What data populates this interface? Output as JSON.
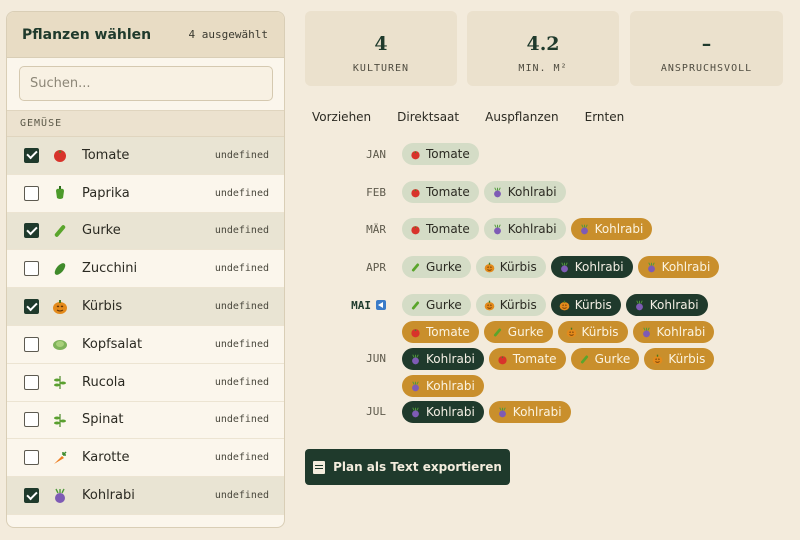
{
  "panel": {
    "title": "Pflanzen wählen",
    "count": "4 ausgewählt",
    "search_placeholder": "Suchen...",
    "group": "GEMÜSE",
    "items": [
      {
        "name": "Tomate",
        "extra": "undefined",
        "checked": true,
        "icon": "tomato-icon"
      },
      {
        "name": "Paprika",
        "extra": "undefined",
        "checked": false,
        "icon": "pepper-icon"
      },
      {
        "name": "Gurke",
        "extra": "undefined",
        "checked": true,
        "icon": "cucumber-icon"
      },
      {
        "name": "Zucchini",
        "extra": "undefined",
        "checked": false,
        "icon": "zucchini-icon"
      },
      {
        "name": "Kürbis",
        "extra": "undefined",
        "checked": true,
        "icon": "pumpkin-icon"
      },
      {
        "name": "Kopfsalat",
        "extra": "undefined",
        "checked": false,
        "icon": "lettuce-icon"
      },
      {
        "name": "Rucola",
        "extra": "undefined",
        "checked": false,
        "icon": "herb-icon"
      },
      {
        "name": "Spinat",
        "extra": "undefined",
        "checked": false,
        "icon": "herb-icon"
      },
      {
        "name": "Karotte",
        "extra": "undefined",
        "checked": false,
        "icon": "carrot-icon"
      },
      {
        "name": "Kohlrabi",
        "extra": "undefined",
        "checked": true,
        "icon": "kohlrabi-icon"
      }
    ]
  },
  "stats": [
    {
      "value": "4",
      "label": "KULTUREN"
    },
    {
      "value": "4.2",
      "label": "MIN. M²"
    },
    {
      "value": "–",
      "label": "ANSPRUCHSVOLL"
    }
  ],
  "legend": [
    "Vorziehen",
    "Direktsaat",
    "Auspflanzen",
    "Ernten"
  ],
  "calendar": [
    {
      "month": "JAN",
      "current": false,
      "chips": [
        {
          "label": "Tomate",
          "kind": "vor",
          "icon": "tomato-icon"
        }
      ]
    },
    {
      "month": "FEB",
      "current": false,
      "chips": [
        {
          "label": "Tomate",
          "kind": "vor",
          "icon": "tomato-icon"
        },
        {
          "label": "Kohlrabi",
          "kind": "vor",
          "icon": "kohlrabi-icon"
        }
      ]
    },
    {
      "month": "MÄR",
      "current": false,
      "chips": [
        {
          "label": "Tomate",
          "kind": "vor",
          "icon": "tomato-icon"
        },
        {
          "label": "Kohlrabi",
          "kind": "vor",
          "icon": "kohlrabi-icon"
        },
        {
          "label": "Kohlrabi",
          "kind": "aus",
          "icon": "kohlrabi-icon"
        }
      ]
    },
    {
      "month": "APR",
      "current": false,
      "chips": [
        {
          "label": "Gurke",
          "kind": "vor",
          "icon": "cucumber-icon"
        },
        {
          "label": "Kürbis",
          "kind": "vor",
          "icon": "pumpkin-icon"
        },
        {
          "label": "Kohlrabi",
          "kind": "dir",
          "icon": "kohlrabi-icon"
        },
        {
          "label": "Kohlrabi",
          "kind": "aus",
          "icon": "kohlrabi-icon"
        }
      ]
    },
    {
      "month": "MAI",
      "current": true,
      "chips": [
        {
          "label": "Gurke",
          "kind": "vor",
          "icon": "cucumber-icon"
        },
        {
          "label": "Kürbis",
          "kind": "vor",
          "icon": "pumpkin-icon"
        },
        {
          "label": "Kürbis",
          "kind": "dir",
          "icon": "pumpkin-icon"
        },
        {
          "label": "Kohlrabi",
          "kind": "dir",
          "icon": "kohlrabi-icon"
        },
        {
          "label": "Tomate",
          "kind": "aus",
          "icon": "tomato-icon"
        },
        {
          "label": "Gurke",
          "kind": "aus",
          "icon": "cucumber-icon"
        },
        {
          "label": "Kürbis",
          "kind": "aus",
          "icon": "pumpkin-icon"
        },
        {
          "label": "Kohlrabi",
          "kind": "aus",
          "icon": "kohlrabi-icon"
        }
      ]
    },
    {
      "month": "JUN",
      "current": false,
      "chips": [
        {
          "label": "Kohlrabi",
          "kind": "dir",
          "icon": "kohlrabi-icon"
        },
        {
          "label": "Tomate",
          "kind": "aus",
          "icon": "tomato-icon"
        },
        {
          "label": "Gurke",
          "kind": "aus",
          "icon": "cucumber-icon"
        },
        {
          "label": "Kürbis",
          "kind": "aus",
          "icon": "pumpkin-icon"
        },
        {
          "label": "Kohlrabi",
          "kind": "aus",
          "icon": "kohlrabi-icon"
        }
      ]
    },
    {
      "month": "JUL",
      "current": false,
      "chips": [
        {
          "label": "Kohlrabi",
          "kind": "dir",
          "icon": "kohlrabi-icon"
        },
        {
          "label": "Kohlrabi",
          "kind": "aus",
          "icon": "kohlrabi-icon"
        }
      ]
    }
  ],
  "export_label": "Plan als Text exportieren",
  "colors": {
    "accent": "#1f3a2c",
    "sow_indoor": "#d4dcc6",
    "direct_sow": "#1f3a2c",
    "transplant": "#c98f2c",
    "background": "#f3ebdc"
  }
}
